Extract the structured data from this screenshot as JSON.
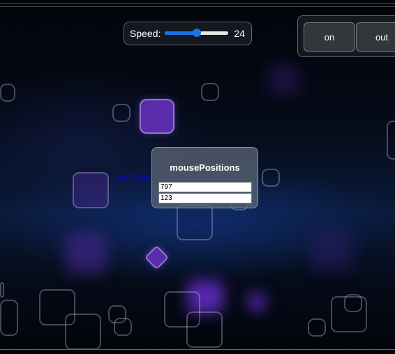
{
  "speed": {
    "label": "Speed:",
    "value": "24",
    "fraction": 0.5
  },
  "mode_buttons": {
    "on_label": "on",
    "out_label": "out"
  },
  "go_back_link": "Go Back",
  "mouse_positions": {
    "title": "mousePositions",
    "x_value": "797",
    "y_value": "123"
  },
  "colors": {
    "accent": "#1a73e8",
    "shape_fill": "#5b2dac",
    "link": "#0000ee"
  }
}
